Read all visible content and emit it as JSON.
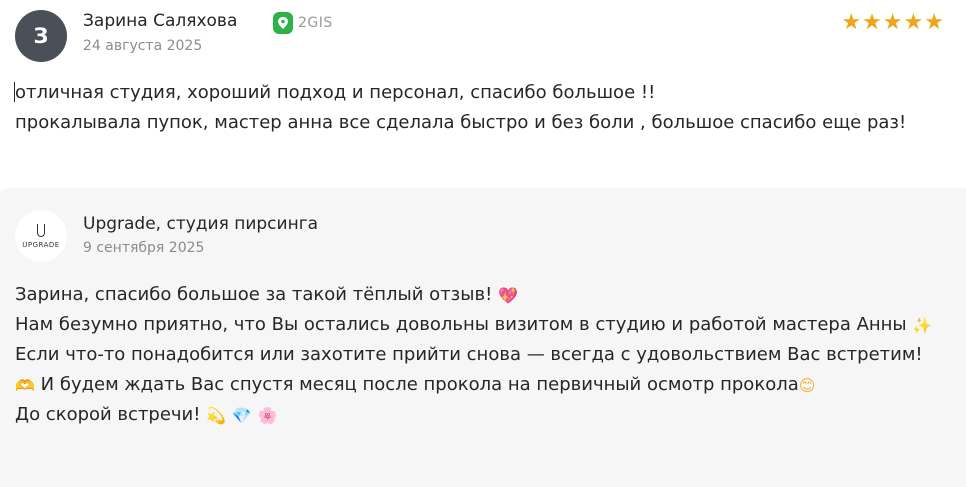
{
  "review": {
    "avatar_letter": "З",
    "author": "Зарина Саляхова",
    "source_label": "2GIS",
    "date": "24 августа 2025",
    "rating": 5,
    "text_lines": [
      "отличная студия, хороший подход и персонал, спасибо большое !!",
      "прокалывала пупок, мастер анна все сделала быстро и без боли , большое спасибо еще раз!"
    ]
  },
  "reply": {
    "logo_text": "UPGRADE",
    "author": "Upgrade, студия пирсинга",
    "date": "9 сентября 2025",
    "line1": "Зарина, спасибо большое за такой тёплый отзыв!",
    "line1_emoji": "💖",
    "line2": "Нам безумно приятно, что Вы остались довольны визитом в студию и работой мастера Анны",
    "line2_emoji": "✨",
    "line3_a": "Если что-то понадобится или захотите прийти снова — всегда с удовольствием Вас встретим!",
    "line3_emoji1": "🫶",
    "line3_b": "И будем ждать Вас спустя месяц после прокола на первичный осмотр прокола",
    "line3_emoji2": "😊",
    "line4": "До скорой встречи!",
    "line4_emojis": [
      "💫",
      "💎",
      "🌸"
    ]
  }
}
